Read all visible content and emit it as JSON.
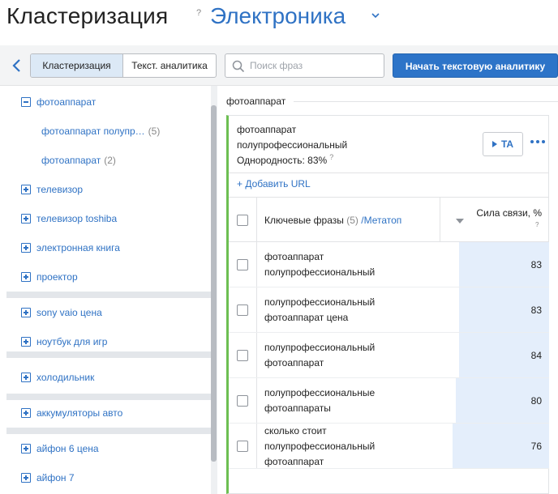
{
  "header": {
    "title": "Кластеризация",
    "help": "?",
    "project": "Электроника"
  },
  "toolbar": {
    "tab_clustering": "Кластеризация",
    "tab_text_analytics": "Текст. аналитика",
    "search_placeholder": "Поиск фраз",
    "start_button": "Начать текстовую аналитику"
  },
  "sidebar": {
    "items": [
      {
        "label": "фотоаппарат",
        "expanded": true,
        "icon": "minus-box-icon"
      },
      {
        "label": "фотоаппарат полупр…",
        "count": "(5)",
        "child": true
      },
      {
        "label": "фотоаппарат",
        "count": "(2)",
        "child": true
      },
      {
        "label": "телевизор",
        "icon": "plus-box-icon"
      },
      {
        "label": "телевизор toshiba",
        "icon": "plus-box-icon"
      },
      {
        "label": "электронная книга",
        "icon": "plus-box-icon"
      },
      {
        "label": "проектор",
        "icon": "plus-box-icon"
      },
      {
        "label": "sony vaio цена",
        "icon": "plus-box-icon"
      },
      {
        "label": "ноутбук для игр",
        "icon": "plus-box-icon"
      },
      {
        "label": "холодильник",
        "icon": "plus-box-icon"
      },
      {
        "label": "аккумуляторы авто",
        "icon": "plus-box-icon"
      },
      {
        "label": "айфон 6 цена",
        "icon": "plus-box-icon"
      },
      {
        "label": "айфон 7",
        "icon": "plus-box-icon"
      }
    ]
  },
  "main": {
    "breadcrumb": "фотоаппарат",
    "cluster": {
      "name_line1": "фотоаппарат",
      "name_line2": "полупрофессиональный",
      "homogeneity": "Однородность: 83%",
      "help": "?",
      "ta_label": "TA",
      "add_url": "+ Добавить URL"
    },
    "table": {
      "header_phrases": "Ключевые фразы",
      "header_count": "(5)",
      "header_metatop": "/Метатоп",
      "header_strength": "Сила связи, %",
      "header_help": "?",
      "rows": [
        {
          "phrase_l1": "фотоаппарат",
          "phrase_l2": "полупрофессиональный",
          "phrase_l3": "",
          "value": "83",
          "pct": 83
        },
        {
          "phrase_l1": "полупрофессиональный",
          "phrase_l2": "фотоаппарат цена",
          "phrase_l3": "",
          "value": "83",
          "pct": 83
        },
        {
          "phrase_l1": "полупрофессиональный",
          "phrase_l2": "фотоаппарат",
          "phrase_l3": "",
          "value": "84",
          "pct": 84
        },
        {
          "phrase_l1": "полупрофессиональные",
          "phrase_l2": "фотоаппараты",
          "phrase_l3": "",
          "value": "80",
          "pct": 80
        },
        {
          "phrase_l1": "сколько стоит",
          "phrase_l2": "полупрофессиональный",
          "phrase_l3": "фотоаппарат",
          "value": "76",
          "pct": 76
        }
      ]
    }
  },
  "colors": {
    "accent": "#2f72c4",
    "primary_button": "#2d74c8",
    "cluster_marker": "#6dbf52",
    "bar_fill": "#e4eefb"
  }
}
